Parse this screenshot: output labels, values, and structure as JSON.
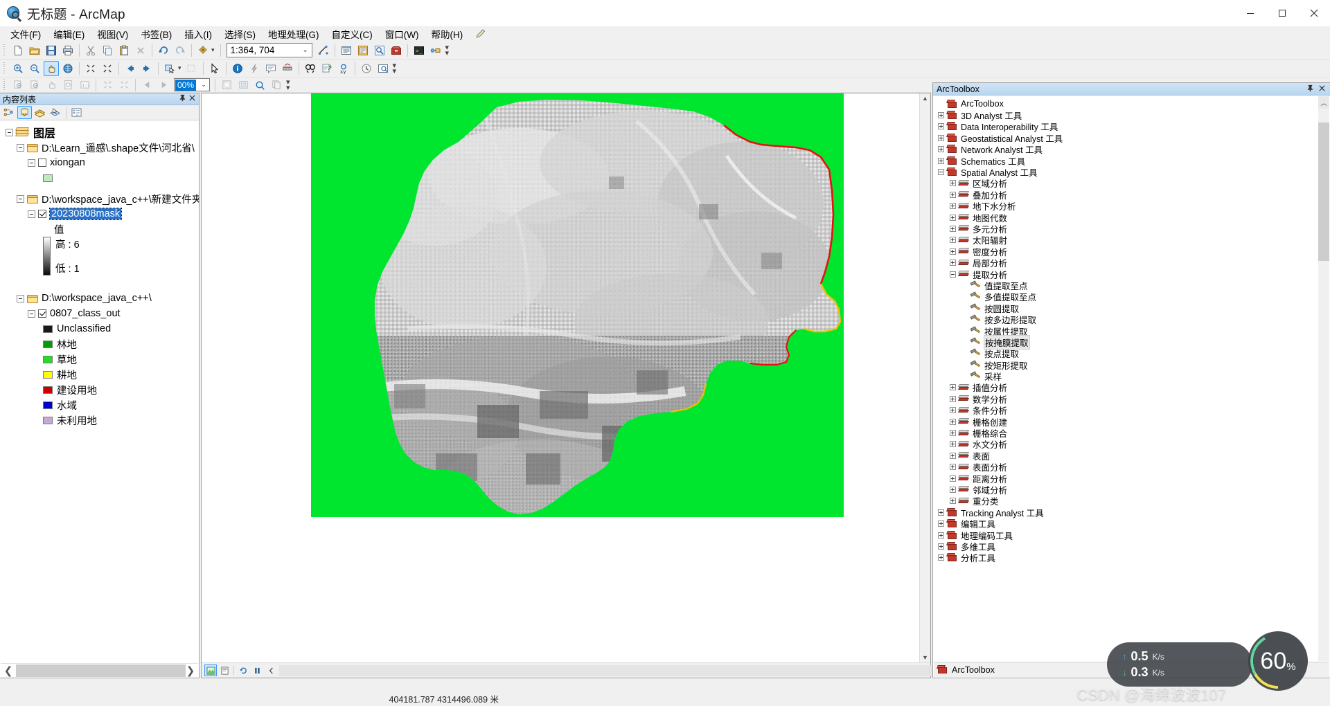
{
  "window": {
    "title": "无标题 - ArcMap",
    "app_icon": "arcmap-globe-icon",
    "minimize": "−",
    "maximize": "▢",
    "close": "✕"
  },
  "menubar": {
    "items": [
      {
        "label": "文件(F)",
        "name": "menu-file"
      },
      {
        "label": "编辑(E)",
        "name": "menu-edit"
      },
      {
        "label": "视图(V)",
        "name": "menu-view"
      },
      {
        "label": "书签(B)",
        "name": "menu-bookmarks"
      },
      {
        "label": "插入(I)",
        "name": "menu-insert"
      },
      {
        "label": "选择(S)",
        "name": "menu-selection"
      },
      {
        "label": "地理处理(G)",
        "name": "menu-geoprocessing"
      },
      {
        "label": "自定义(C)",
        "name": "menu-customize"
      },
      {
        "label": "窗口(W)",
        "name": "menu-window"
      },
      {
        "label": "帮助(H)",
        "name": "menu-help"
      }
    ]
  },
  "toolbar_standard": {
    "scale_value": "1:364, 704",
    "scale_dropdown_arrow": "⌄",
    "buttons": [
      "new-document-icon",
      "open-icon",
      "save-icon",
      "print-icon",
      "cut-icon",
      "copy-icon",
      "paste-icon",
      "delete-icon",
      "undo-icon",
      "redo-icon",
      "add-data-icon",
      "editor-toolbar-icon",
      "table-of-contents-icon",
      "catalog-icon",
      "search-icon",
      "arctoolbox-icon",
      "python-window-icon",
      "model-builder-icon"
    ]
  },
  "toolbar_tools": {
    "buttons": [
      "zoom-in-icon",
      "zoom-out-icon",
      "pan-icon",
      "full-extent-icon",
      "fixed-zoom-in-icon",
      "fixed-zoom-out-icon",
      "previous-extent-icon",
      "next-extent-icon",
      "select-features-icon",
      "clear-selection-icon",
      "select-elements-icon",
      "identify-icon",
      "hyperlink-icon",
      "html-popup-icon",
      "measure-icon",
      "find-icon",
      "find-route-icon",
      "go-to-xy-icon",
      "time-slider-icon",
      "create-viewer-window-icon"
    ],
    "active": "pan-icon"
  },
  "toolbar_layout": {
    "zoom_percent": "00%",
    "zoom_dropdown_arrow": "⌄",
    "buttons": [
      "layout-zoom-in-icon",
      "layout-zoom-out-icon",
      "layout-pan-icon",
      "zoom-whole-page-icon",
      "zoom-100-icon",
      "fixed-zoom-in-icon",
      "fixed-zoom-out-icon",
      "go-back-extent-icon",
      "go-forward-extent-icon",
      "toggle-draft-mode-icon",
      "focus-data-frame-icon",
      "change-layout-icon",
      "data-driven-pages-icon"
    ]
  },
  "toc": {
    "title": "内容列表",
    "pin_icon": "pin-icon",
    "close_icon": "close-icon",
    "toolbar_buttons": [
      {
        "name": "list-by-drawing-order-icon",
        "selected": false
      },
      {
        "name": "list-by-source-icon",
        "selected": true
      },
      {
        "name": "list-by-visibility-icon",
        "selected": false
      },
      {
        "name": "list-by-selection-icon",
        "selected": false
      },
      {
        "name": "options-icon",
        "selected": false
      }
    ],
    "tree": {
      "root_label": "图层",
      "groups": [
        {
          "path": "D:\\Learn_遥感\\.shape文件\\河北省\\",
          "layers": [
            {
              "name": "xiongan",
              "checked": false,
              "selected": false,
              "symbol_color": "#bfe8bd",
              "symbol_type": "polygon-swatch"
            }
          ]
        },
        {
          "path": "D:\\workspace_java_c++\\新建文件夹",
          "layers": [
            {
              "name": "20230808mask",
              "checked": true,
              "selected": true,
              "symbol_type": "stretched-ramp",
              "value_label": "值",
              "high_label": "高 : 6",
              "low_label": "低 : 1"
            }
          ]
        },
        {
          "path": "D:\\workspace_java_c++\\",
          "layers": [
            {
              "name": "0807_class_out",
              "checked": true,
              "selected": false,
              "symbol_type": "unique-values",
              "classes": [
                {
                  "label": "Unclassified",
                  "color": "#1a1a1a"
                },
                {
                  "label": "林地",
                  "color": "#00a000"
                },
                {
                  "label": "草地",
                  "color": "#22dd22"
                },
                {
                  "label": "耕地",
                  "color": "#ffff00"
                },
                {
                  "label": "建设用地",
                  "color": "#cc0000"
                },
                {
                  "label": "水域",
                  "color": "#0000cc"
                },
                {
                  "label": "未利用地",
                  "color": "#c8a8d8"
                }
              ]
            }
          ]
        }
      ]
    },
    "hscroll_left_arrow": "❮",
    "hscroll_right_arrow": "❯"
  },
  "map": {
    "background_color": "#00e62e",
    "data_view_buttons": [
      {
        "name": "data-view-icon",
        "selected": true
      },
      {
        "name": "layout-view-icon",
        "selected": false
      },
      {
        "name": "refresh-view-icon",
        "selected": false
      },
      {
        "name": "pause-drawing-icon",
        "selected": false
      },
      {
        "name": "collapse-icon",
        "selected": false
      }
    ],
    "vscroll_up_arrow": "▲",
    "vscroll_down_arrow": "▼"
  },
  "arctoolbox": {
    "title": "ArcToolbox",
    "pin_icon": "pin-icon",
    "close_icon": "close-icon",
    "root_label": "ArcToolbox",
    "footer_tab": "ArcToolbox",
    "scroll_up_arrow": "︿",
    "nodes": [
      {
        "label": "3D Analyst 工具",
        "level": 1,
        "icon": "toolbox",
        "state": "collapsed"
      },
      {
        "label": "Data Interoperability 工具",
        "level": 1,
        "icon": "toolbox",
        "state": "collapsed"
      },
      {
        "label": "Geostatistical Analyst 工具",
        "level": 1,
        "icon": "toolbox",
        "state": "collapsed"
      },
      {
        "label": "Network Analyst 工具",
        "level": 1,
        "icon": "toolbox",
        "state": "collapsed"
      },
      {
        "label": "Schematics 工具",
        "level": 1,
        "icon": "toolbox",
        "state": "collapsed"
      },
      {
        "label": "Spatial Analyst 工具",
        "level": 1,
        "icon": "toolbox",
        "state": "expanded"
      },
      {
        "label": "区域分析",
        "level": 2,
        "icon": "toolset",
        "state": "collapsed"
      },
      {
        "label": "叠加分析",
        "level": 2,
        "icon": "toolset",
        "state": "collapsed"
      },
      {
        "label": "地下水分析",
        "level": 2,
        "icon": "toolset",
        "state": "collapsed"
      },
      {
        "label": "地图代数",
        "level": 2,
        "icon": "toolset",
        "state": "collapsed"
      },
      {
        "label": "多元分析",
        "level": 2,
        "icon": "toolset",
        "state": "collapsed"
      },
      {
        "label": "太阳辐射",
        "level": 2,
        "icon": "toolset",
        "state": "collapsed"
      },
      {
        "label": "密度分析",
        "level": 2,
        "icon": "toolset",
        "state": "collapsed"
      },
      {
        "label": "局部分析",
        "level": 2,
        "icon": "toolset",
        "state": "collapsed"
      },
      {
        "label": "提取分析",
        "level": 2,
        "icon": "toolset",
        "state": "expanded"
      },
      {
        "label": "值提取至点",
        "level": 3,
        "icon": "tool",
        "state": "leaf"
      },
      {
        "label": "多值提取至点",
        "level": 3,
        "icon": "tool",
        "state": "leaf"
      },
      {
        "label": "按圆提取",
        "level": 3,
        "icon": "tool",
        "state": "leaf"
      },
      {
        "label": "按多边形提取",
        "level": 3,
        "icon": "tool",
        "state": "leaf"
      },
      {
        "label": "按属性提取",
        "level": 3,
        "icon": "tool",
        "state": "leaf"
      },
      {
        "label": "按掩膜提取",
        "level": 3,
        "icon": "tool",
        "state": "leaf",
        "highlighted": true
      },
      {
        "label": "按点提取",
        "level": 3,
        "icon": "tool",
        "state": "leaf"
      },
      {
        "label": "按矩形提取",
        "level": 3,
        "icon": "tool",
        "state": "leaf"
      },
      {
        "label": "采样",
        "level": 3,
        "icon": "tool",
        "state": "leaf"
      },
      {
        "label": "插值分析",
        "level": 2,
        "icon": "toolset",
        "state": "collapsed"
      },
      {
        "label": "数学分析",
        "level": 2,
        "icon": "toolset",
        "state": "collapsed"
      },
      {
        "label": "条件分析",
        "level": 2,
        "icon": "toolset",
        "state": "collapsed"
      },
      {
        "label": "栅格创建",
        "level": 2,
        "icon": "toolset",
        "state": "collapsed"
      },
      {
        "label": "栅格综合",
        "level": 2,
        "icon": "toolset",
        "state": "collapsed"
      },
      {
        "label": "水文分析",
        "level": 2,
        "icon": "toolset",
        "state": "collapsed"
      },
      {
        "label": "表面",
        "level": 2,
        "icon": "toolset",
        "state": "collapsed"
      },
      {
        "label": "表面分析",
        "level": 2,
        "icon": "toolset",
        "state": "collapsed"
      },
      {
        "label": "距离分析",
        "level": 2,
        "icon": "toolset",
        "state": "collapsed"
      },
      {
        "label": "邻域分析",
        "level": 2,
        "icon": "toolset",
        "state": "collapsed"
      },
      {
        "label": "重分类",
        "level": 2,
        "icon": "toolset",
        "state": "collapsed"
      },
      {
        "label": "Tracking Analyst 工具",
        "level": 1,
        "icon": "toolbox",
        "state": "collapsed"
      },
      {
        "label": "编辑工具",
        "level": 1,
        "icon": "toolbox",
        "state": "collapsed"
      },
      {
        "label": "地理编码工具",
        "level": 1,
        "icon": "toolbox",
        "state": "collapsed"
      },
      {
        "label": "多维工具",
        "level": 1,
        "icon": "toolbox",
        "state": "collapsed"
      },
      {
        "label": "分析工具",
        "level": 1,
        "icon": "toolbox",
        "state": "collapsed"
      }
    ]
  },
  "statusbar": {
    "coordinates": "404181.787  4314496.089 米"
  },
  "overlays": {
    "network_monitor": {
      "upload_value": "0.5",
      "upload_unit": "K/s",
      "download_value": "0.3",
      "download_unit": "K/s",
      "upload_arrow": "↑",
      "download_arrow": "↓"
    },
    "cpu_meter": {
      "value": "60",
      "unit": "%"
    },
    "watermark": "CSDN @海绵波波107"
  }
}
